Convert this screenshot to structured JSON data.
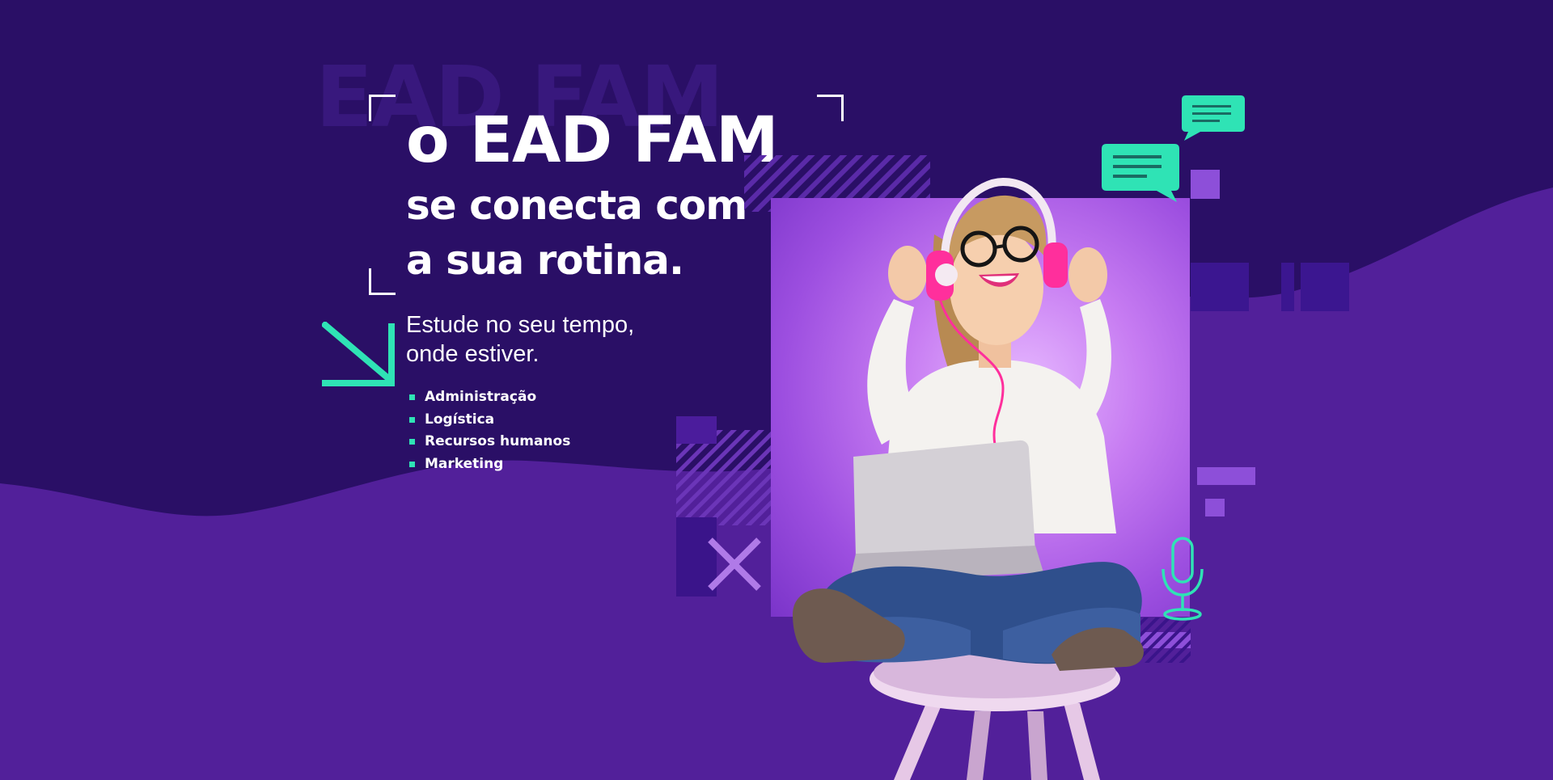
{
  "banner": {
    "ghost_text": "EAD FAM",
    "headline": {
      "line1": "o EAD FAM",
      "line2": "se conecta com",
      "line3": "a sua rotina."
    },
    "subhead": {
      "line1": "Estude no seu tempo,",
      "line2": "onde estiver."
    },
    "courses": [
      "Administração",
      "Logística",
      "Recursos humanos",
      "Marketing"
    ]
  },
  "icons": {
    "arrow": "arrow-down-right-icon",
    "chat_large": "chat-bubble-icon",
    "chat_small": "chat-bubble-icon",
    "microphone": "microphone-icon",
    "cross": "x-mark-icon"
  },
  "colors": {
    "background_dark": "#2a0f66",
    "background_wave": "#52209a",
    "accent_green": "#2fe3b5",
    "text": "#ffffff",
    "panel_purple": "#c77cf2"
  }
}
